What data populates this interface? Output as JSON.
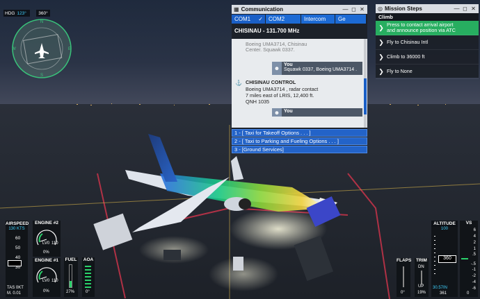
{
  "hud": {
    "heading_label": "HDG",
    "heading_value": "123°",
    "track_value": "360°"
  },
  "communication": {
    "title": "Communication",
    "tabs": [
      "COM1",
      "COM2",
      "Intercom",
      "Ge"
    ],
    "frequency": "CHISINAU - 131.700 MHz",
    "messages": {
      "partial_1": "Boeing UMA3714, Chisinau",
      "partial_2": "Center. Squawk 0337.",
      "you_label_1": "You",
      "you_text_1": "Squawk 0337, Boeing UMA3714 .",
      "sender": "CHISINAU CONTROL",
      "body_1": "Boeing UMA3714 , radar contact",
      "body_2": "7 miles east of LRIS, 12,400 ft.",
      "body_3": "QNH 1035",
      "you_label_2": "You"
    },
    "options": [
      "1 - [ Taxi for Takeoff Options . . . ]",
      "2 - [ Taxi to Parking and Fueling Options . . . ]",
      "3 - [Ground Services]"
    ]
  },
  "mission": {
    "title": "Mission Steps",
    "subtitle": "Climb",
    "steps": [
      {
        "line1": "Press     to contact arrival airport",
        "line2": "and announce position via ATC"
      },
      {
        "line1": "Fly to Chisinau Intl",
        "line2": ""
      },
      {
        "line1": "Climb to 36000 ft",
        "line2": ""
      },
      {
        "line1": "Fly to None",
        "line2": ""
      }
    ]
  },
  "instruments": {
    "airspeed_label": "AIRSPEED",
    "airspeed_value": "130 KTS",
    "airspeed_ticks": [
      "60",
      "50",
      "40",
      "30"
    ],
    "tas_label": "TAS",
    "tas_value": "0KT",
    "mach_label": "M.",
    "mach_value": "0.01",
    "engine2_label": "ENGINE #2",
    "engine1_label": "ENGINE #1",
    "engine_pct": "0%",
    "engine_n1": "LV0",
    "engine_small": "110",
    "fuel_label": "FUEL",
    "fuel_value": "27%",
    "aoa_label": "AOA",
    "aoa_value": "0°",
    "flaps_label": "FLAPS",
    "flaps_value": "0°",
    "trim_label": "TRIM",
    "trim_dn": "DN",
    "trim_up": "UP",
    "trim_value": "19%",
    "altitude_label": "ALTITUDE",
    "altitude_top": "100",
    "altitude_value": "360",
    "altitude_baro": "30.57IN",
    "altitude_bottom": "361",
    "vs_label": "VS",
    "vs_ticks": [
      "6",
      "4",
      "2",
      "1",
      ".5",
      "-.5",
      "-1",
      "-2",
      "-4",
      "-6"
    ],
    "vs_value": "0"
  }
}
